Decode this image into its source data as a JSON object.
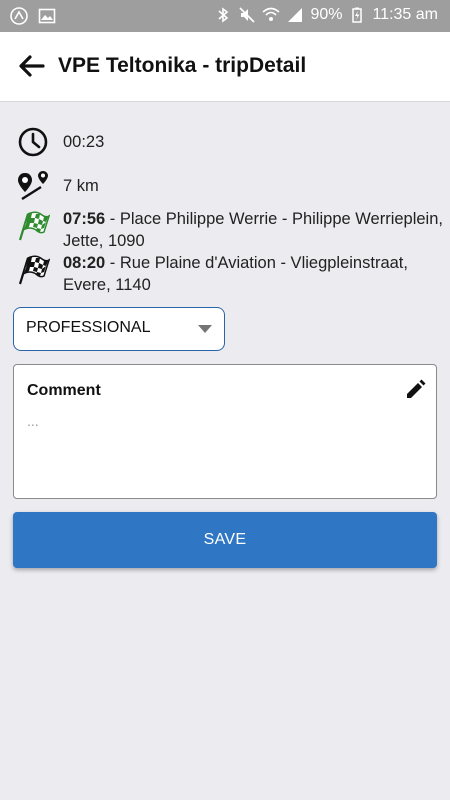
{
  "status_bar": {
    "battery": "90%",
    "time": "11:35 am"
  },
  "header": {
    "title": "VPE Teltonika - tripDetail"
  },
  "trip": {
    "duration": "00:23",
    "distance": "7 km",
    "start_time": "07:56",
    "start_address": " - Place Philippe Werrie - Philippe Werrieplein, Jette, 1090",
    "end_time": "08:20",
    "end_address": " - Rue Plaine d'Aviation - Vliegpleinstraat, Evere, 1140"
  },
  "trip_type": {
    "selected": "PROFESSIONAL"
  },
  "comment": {
    "label": "Comment",
    "placeholder": "..."
  },
  "actions": {
    "save_label": "SAVE"
  },
  "colors": {
    "accent": "#2f76c5",
    "start_flag": "#2e8b2e",
    "background": "#ebebf0"
  }
}
